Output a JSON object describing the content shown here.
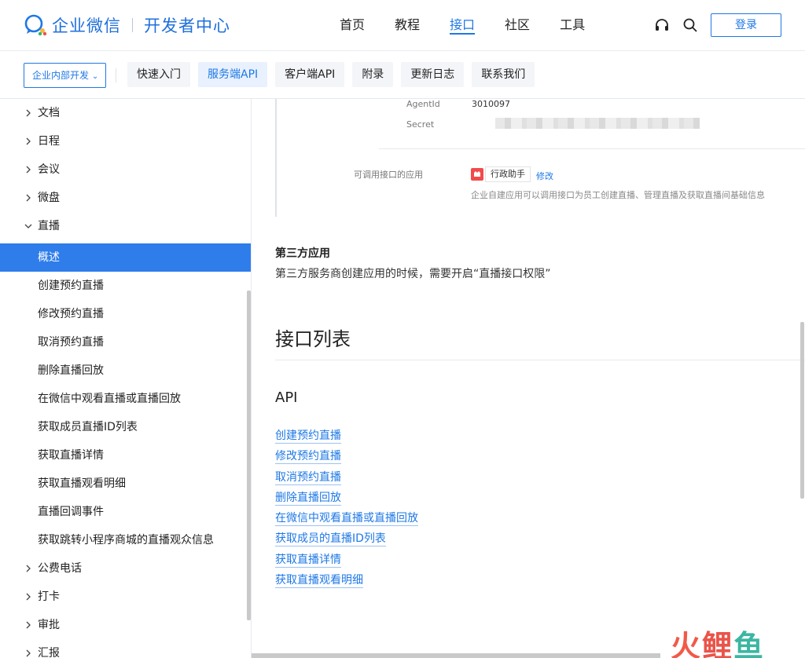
{
  "brand": {
    "name": "企业微信",
    "section": "开发者中心",
    "color": "#1e78e6"
  },
  "nav": [
    {
      "label": "首页",
      "active": false
    },
    {
      "label": "教程",
      "active": false
    },
    {
      "label": "接口",
      "active": true
    },
    {
      "label": "社区",
      "active": false
    },
    {
      "label": "工具",
      "active": false
    }
  ],
  "header": {
    "login_label": "登录",
    "headset_icon": "headset-icon",
    "search_icon": "search-icon"
  },
  "subbar": {
    "dept_select": "企业内部开发",
    "chips": [
      {
        "label": "快速入门",
        "active": false
      },
      {
        "label": "服务端API",
        "active": true
      },
      {
        "label": "客户端API",
        "active": false
      },
      {
        "label": "附录",
        "active": false
      },
      {
        "label": "更新日志",
        "active": false
      },
      {
        "label": "联系我们",
        "active": false
      }
    ]
  },
  "sidebar": {
    "items": [
      {
        "label": "文档",
        "type": "group",
        "expanded": false
      },
      {
        "label": "日程",
        "type": "group",
        "expanded": false
      },
      {
        "label": "会议",
        "type": "group",
        "expanded": false
      },
      {
        "label": "微盘",
        "type": "group",
        "expanded": false
      },
      {
        "label": "直播",
        "type": "group",
        "expanded": true
      },
      {
        "label": "概述",
        "type": "child",
        "active": true
      },
      {
        "label": "创建预约直播",
        "type": "child"
      },
      {
        "label": "修改预约直播",
        "type": "child"
      },
      {
        "label": "取消预约直播",
        "type": "child"
      },
      {
        "label": "删除直播回放",
        "type": "child"
      },
      {
        "label": "在微信中观看直播或直播回放",
        "type": "child"
      },
      {
        "label": "获取成员直播ID列表",
        "type": "child"
      },
      {
        "label": "获取直播详情",
        "type": "child"
      },
      {
        "label": "获取直播观看明细",
        "type": "child"
      },
      {
        "label": "直播回调事件",
        "type": "child"
      },
      {
        "label": "获取跳转小程序商城的直播观众信息",
        "type": "child"
      },
      {
        "label": "公费电话",
        "type": "group",
        "expanded": false
      },
      {
        "label": "打卡",
        "type": "group",
        "expanded": false
      },
      {
        "label": "审批",
        "type": "group",
        "expanded": false
      },
      {
        "label": "汇报",
        "type": "group",
        "expanded": false
      }
    ]
  },
  "main": {
    "screenshot": {
      "agentid_label": "AgentId",
      "agentid_value": "3010097",
      "secret_label": "Secret",
      "apps_label": "可调用接口的应用",
      "app_name": "行政助手",
      "modify_label": "修改",
      "app_desc": "企业自建应用可以调用接口为员工创建直播、管理直播及获取直播间基础信息"
    },
    "third_party_title": "第三方应用",
    "third_party_text": "第三方服务商创建应用的时候，需要开启“直播接口权限”",
    "list_title": "接口列表",
    "api_title": "API",
    "api_links": [
      "创建预约直播",
      "修改预约直播",
      "取消预约直播",
      "删除直播回放",
      "在微信中观看直播或直播回放",
      "获取成员的直播ID列表",
      "获取直播详情",
      "获取直播观看明细"
    ]
  },
  "watermark": [
    "火",
    "鲤",
    "鱼"
  ]
}
